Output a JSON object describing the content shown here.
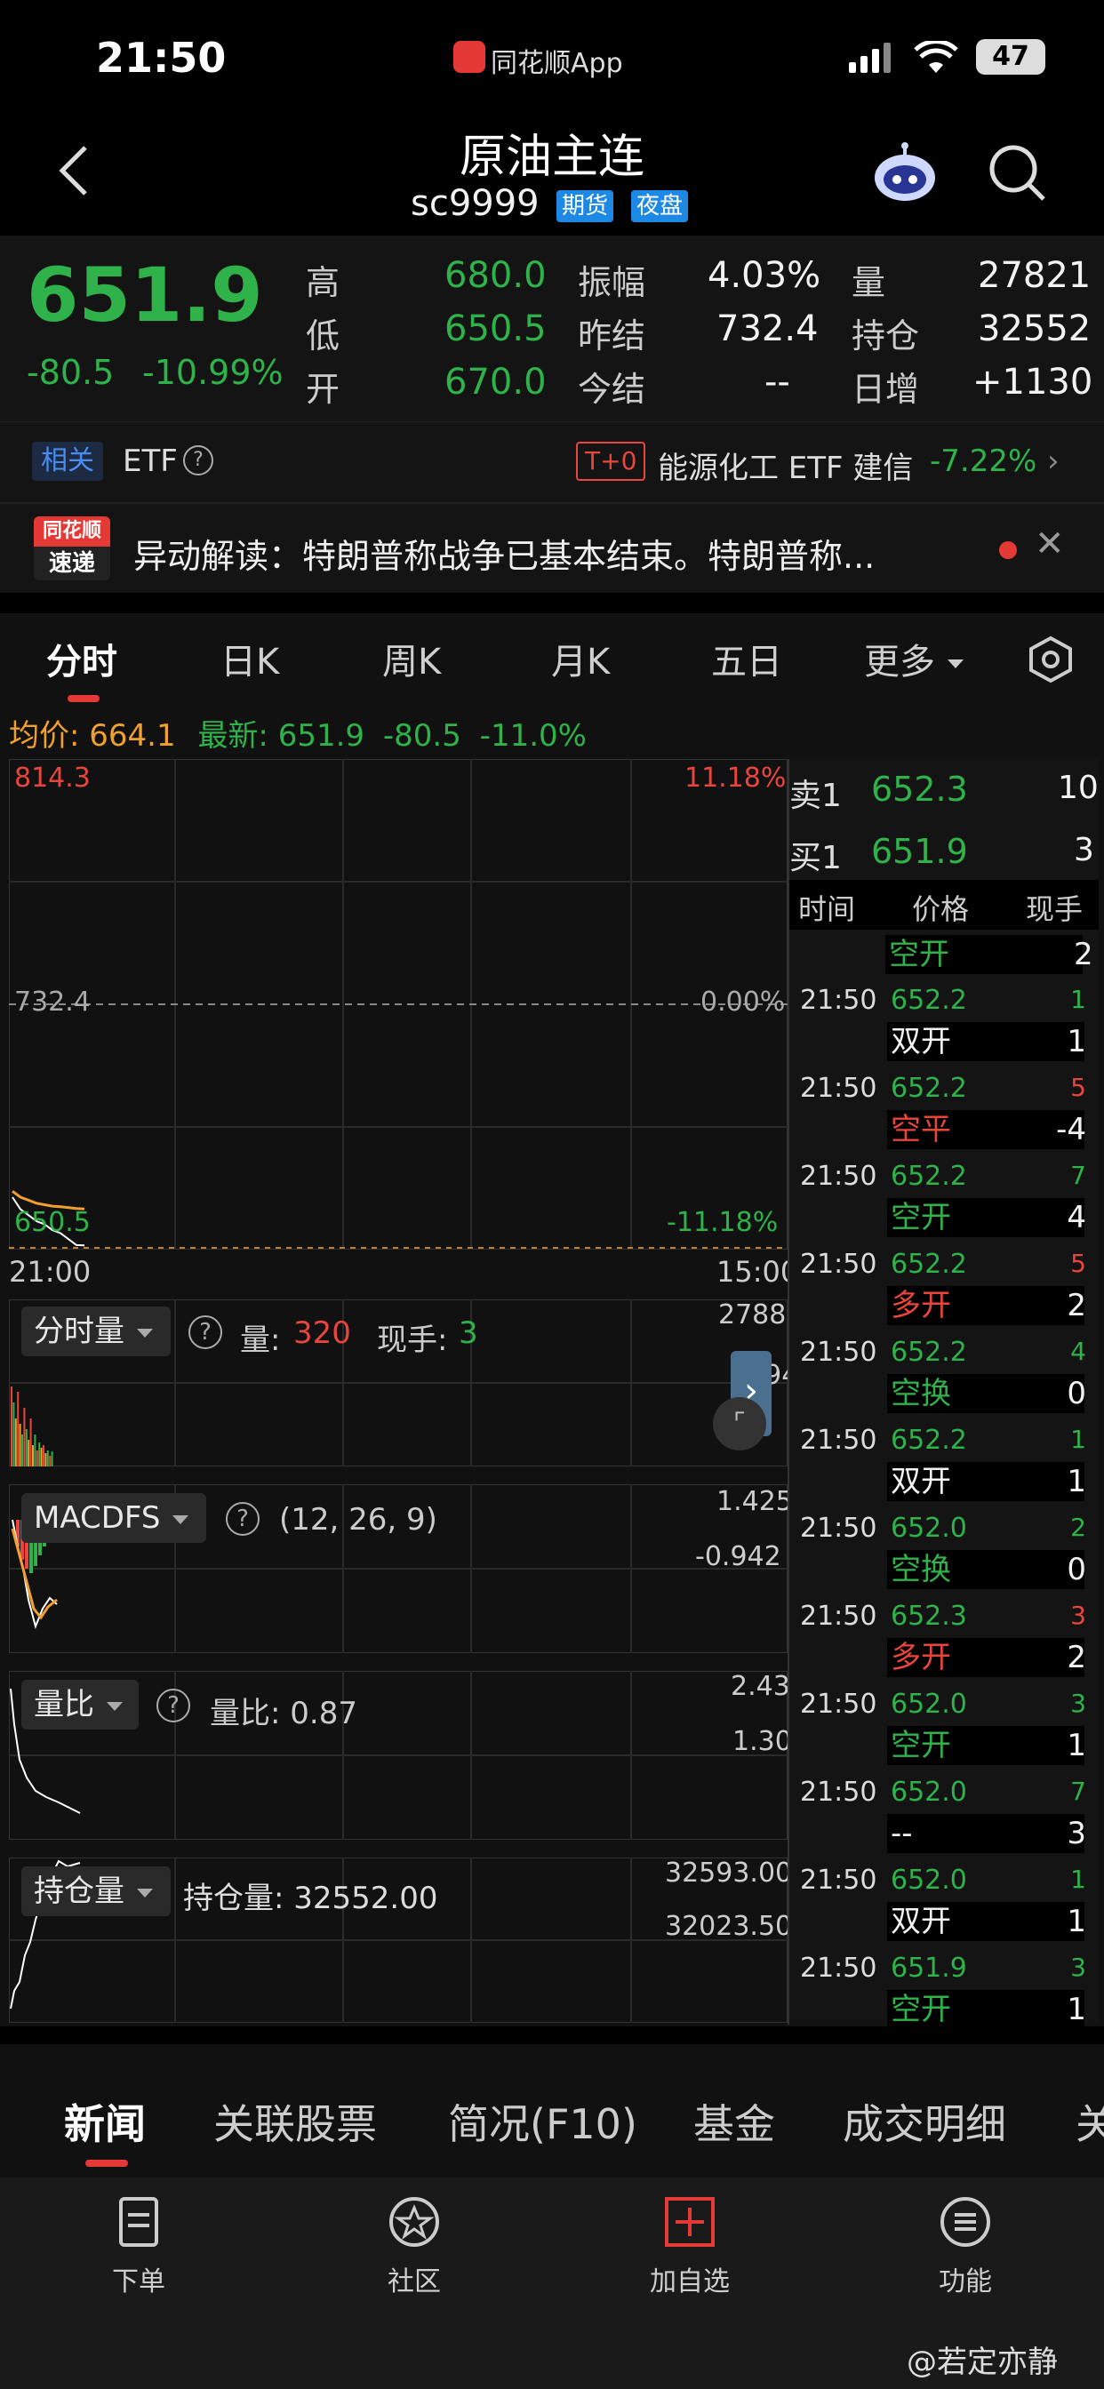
{
  "status_bar": {
    "time": "21:50",
    "app_name": "同花顺App",
    "battery": "47"
  },
  "header": {
    "title": "原油主连",
    "code": "sc9999",
    "badge_futures": "期货",
    "badge_night": "夜盘"
  },
  "quote": {
    "price": "651.9",
    "change": "-80.5",
    "change_pct": "-10.99%",
    "fields": [
      {
        "label": "高",
        "value": "680.0"
      },
      {
        "label": "低",
        "value": "650.5"
      },
      {
        "label": "开",
        "value": "670.0"
      },
      {
        "label": "振幅",
        "value": "4.03%"
      },
      {
        "label": "昨结",
        "value": "732.4"
      },
      {
        "label": "今结",
        "value": "--"
      },
      {
        "label": "量",
        "value": "27821"
      },
      {
        "label": "持仓",
        "value": "32552"
      },
      {
        "label": "日增",
        "value": "+1130"
      }
    ]
  },
  "etf": {
    "tag": "相关",
    "label": "ETF",
    "t0": "T+0",
    "name": "能源化工 ETF 建信",
    "pct": "-7.22%"
  },
  "news_banner": {
    "logo_top": "同花顺",
    "logo_bottom": "速递",
    "text": "异动解读：特朗普称战争已基本结束。特朗普称..."
  },
  "tabs": [
    "分时",
    "日K",
    "周K",
    "月K",
    "五日",
    "更多"
  ],
  "summary": {
    "avg_label": "均价:",
    "avg_value": "664.1",
    "latest_label": "最新:",
    "latest_value": "651.9",
    "change": "-80.5",
    "pct": "-11.0%"
  },
  "main_chart": {
    "y_top": "814.3",
    "y_mid": "732.4",
    "y_bottom": "650.5",
    "pct_top": "11.18%",
    "pct_mid": "0.00%",
    "pct_bottom": "-11.18%",
    "time_start": "21:00",
    "time_end": "15:00"
  },
  "chart_data": {
    "type": "line",
    "title": "",
    "series": [
      {
        "name": "最新",
        "values": [
          668,
          664,
          662,
          660,
          659,
          657,
          656,
          654,
          652,
          651.9
        ]
      },
      {
        "name": "均价",
        "values": [
          670,
          668,
          667,
          666,
          665.5,
          665,
          664.8,
          664.5,
          664.2,
          664.1
        ]
      }
    ],
    "ylim": [
      650.5,
      814.3
    ]
  },
  "volume_panel": {
    "selector": "分时量",
    "vol_label": "量:",
    "vol_value": "320",
    "hand_label": "现手:",
    "hand_value": "3",
    "y_top": "2788",
    "y_mid": "1394"
  },
  "macd_panel": {
    "selector": "MACDFS",
    "params": "(12, 26, 9)",
    "y_top": "1.425",
    "y_mid": "-0.942"
  },
  "ratio_panel": {
    "selector": "量比",
    "label": "量比: 0.87",
    "y_top": "2.43",
    "y_mid": "1.30"
  },
  "oi_panel": {
    "selector": "持仓量",
    "label": "持仓量: 32552.00",
    "y_top": "32593.00",
    "y_mid": "32023.50"
  },
  "order_book": {
    "sell_label": "卖1",
    "sell_price": "652.3",
    "sell_qty": "10",
    "buy_label": "买1",
    "buy_price": "651.9",
    "buy_qty": "3",
    "headers": [
      "时间",
      "价格",
      "现手"
    ],
    "first_type": "空开",
    "first_qty": "2",
    "trades": [
      {
        "time": "21:50",
        "price": "652.2",
        "hand": "1",
        "hand_color": "#2fb24a",
        "type": "双开",
        "type_color": "#f2f2f2",
        "qty": "1"
      },
      {
        "time": "21:50",
        "price": "652.2",
        "hand": "5",
        "hand_color": "#e8453c",
        "type": "空平",
        "type_color": "#e8453c",
        "qty": "-4"
      },
      {
        "time": "21:50",
        "price": "652.2",
        "hand": "7",
        "hand_color": "#2fb24a",
        "type": "空开",
        "type_color": "#2fb24a",
        "qty": "4"
      },
      {
        "time": "21:50",
        "price": "652.2",
        "hand": "5",
        "hand_color": "#e8453c",
        "type": "多开",
        "type_color": "#e8453c",
        "qty": "2"
      },
      {
        "time": "21:50",
        "price": "652.2",
        "hand": "4",
        "hand_color": "#2fb24a",
        "type": "空换",
        "type_color": "#2fb24a",
        "qty": "0"
      },
      {
        "time": "21:50",
        "price": "652.2",
        "hand": "1",
        "hand_color": "#2fb24a",
        "type": "双开",
        "type_color": "#f2f2f2",
        "qty": "1"
      },
      {
        "time": "21:50",
        "price": "652.0",
        "hand": "2",
        "hand_color": "#2fb24a",
        "type": "空换",
        "type_color": "#2fb24a",
        "qty": "0"
      },
      {
        "time": "21:50",
        "price": "652.3",
        "hand": "3",
        "hand_color": "#e8453c",
        "type": "多开",
        "type_color": "#e8453c",
        "qty": "2"
      },
      {
        "time": "21:50",
        "price": "652.0",
        "hand": "3",
        "hand_color": "#2fb24a",
        "type": "空开",
        "type_color": "#2fb24a",
        "qty": "1"
      },
      {
        "time": "21:50",
        "price": "652.0",
        "hand": "7",
        "hand_color": "#2fb24a",
        "type": "--",
        "type_color": "#f2f2f2",
        "qty": "3"
      },
      {
        "time": "21:50",
        "price": "652.0",
        "hand": "1",
        "hand_color": "#2fb24a",
        "type": "双开",
        "type_color": "#f2f2f2",
        "qty": "1"
      },
      {
        "time": "21:50",
        "price": "651.9",
        "hand": "3",
        "hand_color": "#2fb24a",
        "type": "空开",
        "type_color": "#2fb24a",
        "qty": "1"
      }
    ]
  },
  "bottom_tabs": [
    "新闻",
    "关联股票",
    "简况(F10)",
    "基金",
    "成交明细",
    "关"
  ],
  "bottom_nav": [
    {
      "label": "下单",
      "icon": "document-icon"
    },
    {
      "label": "社区",
      "icon": "star-badge-icon"
    },
    {
      "label": "加自选",
      "icon": "add-box-icon"
    },
    {
      "label": "功能",
      "icon": "menu-circle-icon"
    }
  ],
  "watermark": "@若定亦静",
  "colors": {
    "up": "#e8453c",
    "down": "#2fb24a",
    "avg": "#f0a030",
    "accent": "#1e88e5"
  }
}
